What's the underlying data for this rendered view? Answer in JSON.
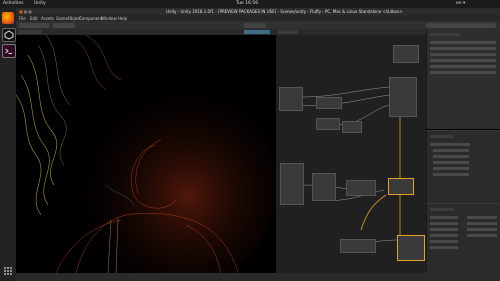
{
  "os_panel": {
    "activities": "Activities",
    "app": "Unity",
    "clock": "Tue 16:56",
    "right_status": "en ▾"
  },
  "window": {
    "title": "Unity - Unity 2018.1.0f1 - [PREVIEW PACKAGES IN USE] - Scenes/unity - Fluffy - PC, Mac & Linux Standalone <Vulkan>"
  },
  "menu": [
    "File",
    "Edit",
    "Assets",
    "GameObject",
    "Component",
    "Window",
    "Help"
  ],
  "colors": {
    "accent_selection": "#e1a21f",
    "node_blue": "#4aa9c8",
    "ubuntu_orange": "#dd4814"
  },
  "icons": [
    "firefox-icon",
    "unity-icon",
    "terminal-icon",
    "apps-grid-icon"
  ]
}
